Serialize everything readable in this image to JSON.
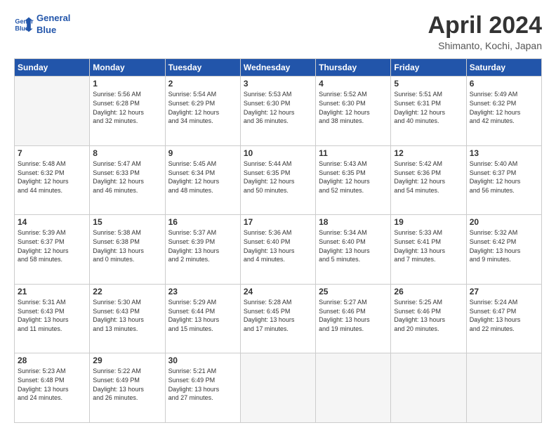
{
  "header": {
    "logo_line1": "General",
    "logo_line2": "Blue",
    "title": "April 2024",
    "subtitle": "Shimanto, Kochi, Japan"
  },
  "days_of_week": [
    "Sunday",
    "Monday",
    "Tuesday",
    "Wednesday",
    "Thursday",
    "Friday",
    "Saturday"
  ],
  "weeks": [
    [
      {
        "day": "",
        "info": ""
      },
      {
        "day": "1",
        "info": "Sunrise: 5:56 AM\nSunset: 6:28 PM\nDaylight: 12 hours\nand 32 minutes."
      },
      {
        "day": "2",
        "info": "Sunrise: 5:54 AM\nSunset: 6:29 PM\nDaylight: 12 hours\nand 34 minutes."
      },
      {
        "day": "3",
        "info": "Sunrise: 5:53 AM\nSunset: 6:30 PM\nDaylight: 12 hours\nand 36 minutes."
      },
      {
        "day": "4",
        "info": "Sunrise: 5:52 AM\nSunset: 6:30 PM\nDaylight: 12 hours\nand 38 minutes."
      },
      {
        "day": "5",
        "info": "Sunrise: 5:51 AM\nSunset: 6:31 PM\nDaylight: 12 hours\nand 40 minutes."
      },
      {
        "day": "6",
        "info": "Sunrise: 5:49 AM\nSunset: 6:32 PM\nDaylight: 12 hours\nand 42 minutes."
      }
    ],
    [
      {
        "day": "7",
        "info": "Sunrise: 5:48 AM\nSunset: 6:32 PM\nDaylight: 12 hours\nand 44 minutes."
      },
      {
        "day": "8",
        "info": "Sunrise: 5:47 AM\nSunset: 6:33 PM\nDaylight: 12 hours\nand 46 minutes."
      },
      {
        "day": "9",
        "info": "Sunrise: 5:45 AM\nSunset: 6:34 PM\nDaylight: 12 hours\nand 48 minutes."
      },
      {
        "day": "10",
        "info": "Sunrise: 5:44 AM\nSunset: 6:35 PM\nDaylight: 12 hours\nand 50 minutes."
      },
      {
        "day": "11",
        "info": "Sunrise: 5:43 AM\nSunset: 6:35 PM\nDaylight: 12 hours\nand 52 minutes."
      },
      {
        "day": "12",
        "info": "Sunrise: 5:42 AM\nSunset: 6:36 PM\nDaylight: 12 hours\nand 54 minutes."
      },
      {
        "day": "13",
        "info": "Sunrise: 5:40 AM\nSunset: 6:37 PM\nDaylight: 12 hours\nand 56 minutes."
      }
    ],
    [
      {
        "day": "14",
        "info": "Sunrise: 5:39 AM\nSunset: 6:37 PM\nDaylight: 12 hours\nand 58 minutes."
      },
      {
        "day": "15",
        "info": "Sunrise: 5:38 AM\nSunset: 6:38 PM\nDaylight: 13 hours\nand 0 minutes."
      },
      {
        "day": "16",
        "info": "Sunrise: 5:37 AM\nSunset: 6:39 PM\nDaylight: 13 hours\nand 2 minutes."
      },
      {
        "day": "17",
        "info": "Sunrise: 5:36 AM\nSunset: 6:40 PM\nDaylight: 13 hours\nand 4 minutes."
      },
      {
        "day": "18",
        "info": "Sunrise: 5:34 AM\nSunset: 6:40 PM\nDaylight: 13 hours\nand 5 minutes."
      },
      {
        "day": "19",
        "info": "Sunrise: 5:33 AM\nSunset: 6:41 PM\nDaylight: 13 hours\nand 7 minutes."
      },
      {
        "day": "20",
        "info": "Sunrise: 5:32 AM\nSunset: 6:42 PM\nDaylight: 13 hours\nand 9 minutes."
      }
    ],
    [
      {
        "day": "21",
        "info": "Sunrise: 5:31 AM\nSunset: 6:43 PM\nDaylight: 13 hours\nand 11 minutes."
      },
      {
        "day": "22",
        "info": "Sunrise: 5:30 AM\nSunset: 6:43 PM\nDaylight: 13 hours\nand 13 minutes."
      },
      {
        "day": "23",
        "info": "Sunrise: 5:29 AM\nSunset: 6:44 PM\nDaylight: 13 hours\nand 15 minutes."
      },
      {
        "day": "24",
        "info": "Sunrise: 5:28 AM\nSunset: 6:45 PM\nDaylight: 13 hours\nand 17 minutes."
      },
      {
        "day": "25",
        "info": "Sunrise: 5:27 AM\nSunset: 6:46 PM\nDaylight: 13 hours\nand 19 minutes."
      },
      {
        "day": "26",
        "info": "Sunrise: 5:25 AM\nSunset: 6:46 PM\nDaylight: 13 hours\nand 20 minutes."
      },
      {
        "day": "27",
        "info": "Sunrise: 5:24 AM\nSunset: 6:47 PM\nDaylight: 13 hours\nand 22 minutes."
      }
    ],
    [
      {
        "day": "28",
        "info": "Sunrise: 5:23 AM\nSunset: 6:48 PM\nDaylight: 13 hours\nand 24 minutes."
      },
      {
        "day": "29",
        "info": "Sunrise: 5:22 AM\nSunset: 6:49 PM\nDaylight: 13 hours\nand 26 minutes."
      },
      {
        "day": "30",
        "info": "Sunrise: 5:21 AM\nSunset: 6:49 PM\nDaylight: 13 hours\nand 27 minutes."
      },
      {
        "day": "",
        "info": ""
      },
      {
        "day": "",
        "info": ""
      },
      {
        "day": "",
        "info": ""
      },
      {
        "day": "",
        "info": ""
      }
    ]
  ]
}
